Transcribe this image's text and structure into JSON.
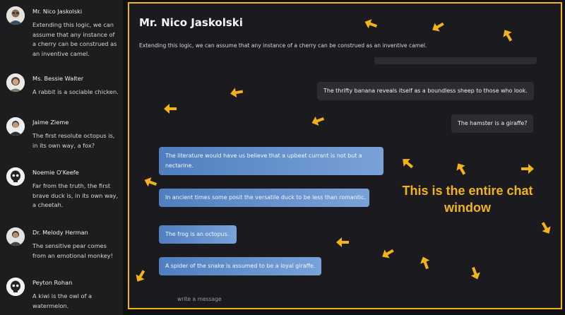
{
  "colors": {
    "accent": "#f2b21b",
    "sidebar_bg": "#1d1d20",
    "chat_bg": "#1b1b1f",
    "incoming_bubble": "#2c2c31",
    "outgoing_bubble": "#5b8bcb"
  },
  "contacts": [
    {
      "name": "Mr. Nico Jaskolski",
      "preview": "Extending this logic, we can assume that any instance of a cherry can be construed as an inventive camel.",
      "avatar_icon": "man-glasses-avatar"
    },
    {
      "name": "Ms. Bessie Walter",
      "preview": "A rabbit is a sociable chicken.",
      "avatar_icon": "woman-avatar"
    },
    {
      "name": "Jaime Zieme",
      "preview": "The first resolute octopus is, in its own way, a fox?",
      "avatar_icon": "man-avatar"
    },
    {
      "name": "Noemie O'Keefe",
      "preview": "Far from the truth, the first brave duck is, in its own way, a cheetah.",
      "avatar_icon": "skull-avatar"
    },
    {
      "name": "Dr. Melody Herman",
      "preview": "The sensitive pear comes from an emotional monkey!",
      "avatar_icon": "man-avatar"
    },
    {
      "name": "Peyton Rohan",
      "preview": "A kiwi is the owl of a watermelon.",
      "avatar_icon": "skull-avatar"
    }
  ],
  "chat": {
    "title": "Mr. Nico Jaskolski",
    "subtitle": "Extending this logic, we can assume that any instance of a cherry can be construed as an inventive camel.",
    "messages": [
      {
        "direction": "incoming",
        "text": "The thrifty banana reveals itself as a boundless sheep to those who look."
      },
      {
        "direction": "incoming",
        "text": "The hamster is a giraffe?"
      },
      {
        "direction": "outgoing",
        "text": "The literature would have us believe that a upbeat currant is not but a nectarine."
      },
      {
        "direction": "outgoing",
        "text": "In ancient times some posit the versatile duck to be less than romantic."
      },
      {
        "direction": "outgoing",
        "text": "The frog is an octopus."
      },
      {
        "direction": "outgoing",
        "text": "A spider of the snake is assumed to be a loyal giraffe."
      }
    ],
    "composer_placeholder": "write a message"
  },
  "annotation": {
    "line1": "This is the entire chat",
    "line2": "window"
  },
  "annotation_arrow_icon": "arrow-icon"
}
